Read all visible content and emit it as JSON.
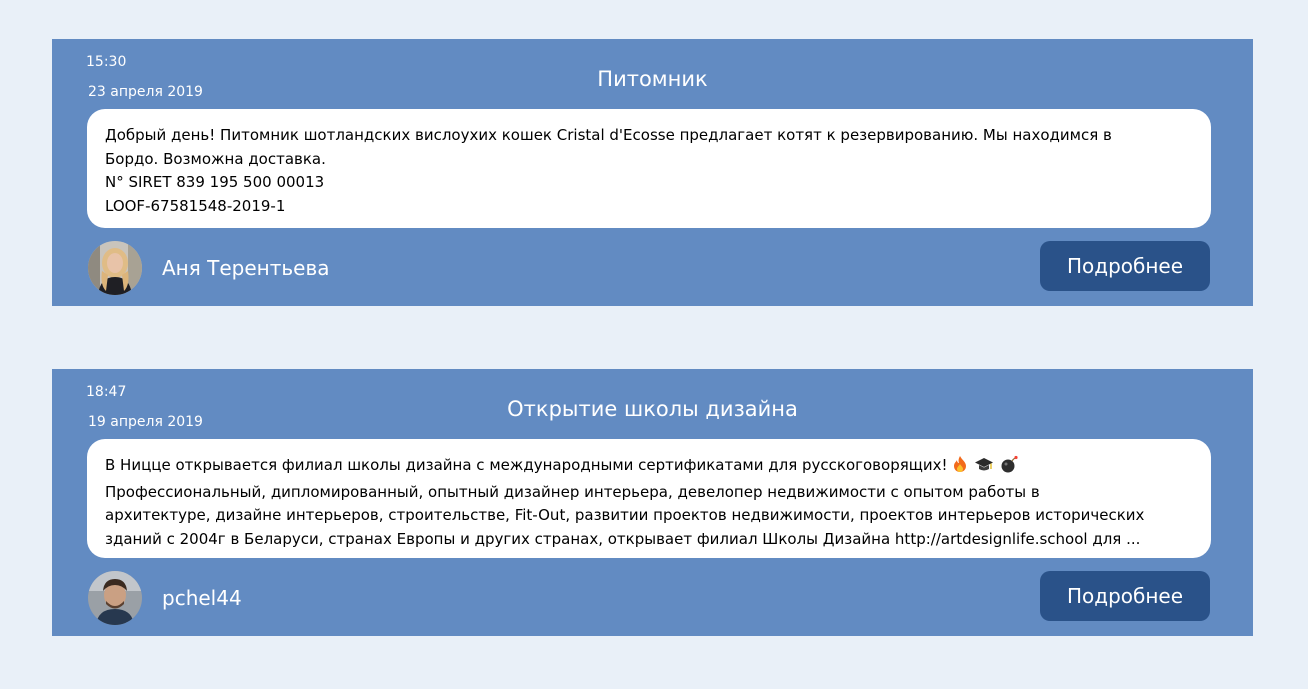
{
  "posts": [
    {
      "time": "15:30",
      "date": "23 апреля 2019",
      "title": "Питомник",
      "lines": [
        "Добрый день! Питомник шотландских вислоухих кошек Cristal d'Ecosse предлагает котят к резервированию. Мы находимся в",
        "Бордо. Возможна доставка.",
        "N° SIRET 839 195 500 00013",
        "LOOF-67581548-2019-1"
      ],
      "author": "Аня Терентьева",
      "button": "Подробнее"
    },
    {
      "time": "18:47",
      "date": "19 апреля 2019",
      "title": "Открытие школы дизайна",
      "lines": [
        "В Ницце открывается филиал школы дизайна с международными сертификатами для русскоговорящих!",
        "Профессиональный, дипломированный, опытный дизайнер интерьера, девелопер недвижимости с опытом работы в",
        "архитектуре, дизайне интерьеров, строительстве, Fit-Out, развитии проектов недвижимости, проектов интерьеров исторических",
        "зданий с 2004г в Беларуси, странах Европы и других странах, открывает филиал Школы Дизайна http://artdesignlife.school для ..."
      ],
      "emoji_icons": [
        "fire-icon",
        "graduation-cap-icon",
        "bomb-icon"
      ],
      "author": "pchel44",
      "button": "Подробнее"
    }
  ],
  "colors": {
    "page_bg": "#e9f0f8",
    "card_bg": "#628bc2",
    "button_bg": "#2a5289",
    "body_bg": "#ffffff"
  }
}
